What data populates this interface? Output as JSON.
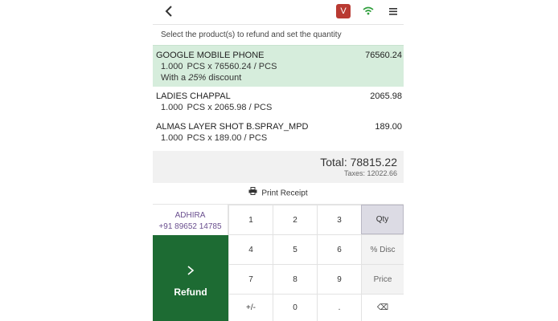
{
  "header": {
    "avatar_letter": "V",
    "icons": [
      "back-arrow-icon",
      "wifi-icon",
      "hamburger-menu-icon"
    ],
    "avatar_color": "#b93a32",
    "wifi_color": "#2e9e3b"
  },
  "instruction": "Select the product(s) to refund and set the quantity",
  "lines": [
    {
      "name": "GOOGLE MOBILE PHONE",
      "price": "76560.24",
      "qty": "1.000",
      "detail": "PCS x 76560.24 / PCS",
      "discount_prefix": "With a",
      "discount_value": "25%",
      "discount_suffix": "discount",
      "selected": true
    },
    {
      "name": "LADIES CHAPPAL",
      "price": "2065.98",
      "qty": "1.000",
      "detail": "PCS x 2065.98 / PCS"
    },
    {
      "name": "ALMAS LAYER SHOT B.SPRAY_MPD",
      "price": "189.00",
      "qty": "1.000",
      "detail": "PCS x 189.00 / PCS"
    }
  ],
  "summary": {
    "total": "Total: 78815.22",
    "taxes": "Taxes: 12022.66"
  },
  "print_receipt": "Print Receipt",
  "customer": {
    "name": "ADHIRA",
    "phone": "+91 89652 14785"
  },
  "refund_label": "Refund",
  "numpad": {
    "k1": "1",
    "k2": "2",
    "k3": "3",
    "qty": "Qty",
    "k4": "4",
    "k5": "5",
    "k6": "6",
    "disc": "% Disc",
    "k7": "7",
    "k8": "8",
    "k9": "9",
    "price": "Price",
    "plusminus": "+/-",
    "k0": "0",
    "dot": ".",
    "backspace": "⌫"
  },
  "colors": {
    "selected_line": "#d6eddc",
    "refund_button": "#1d6b33",
    "customer_text": "#6a4f8f",
    "active_mode": "#dcdbe4"
  }
}
